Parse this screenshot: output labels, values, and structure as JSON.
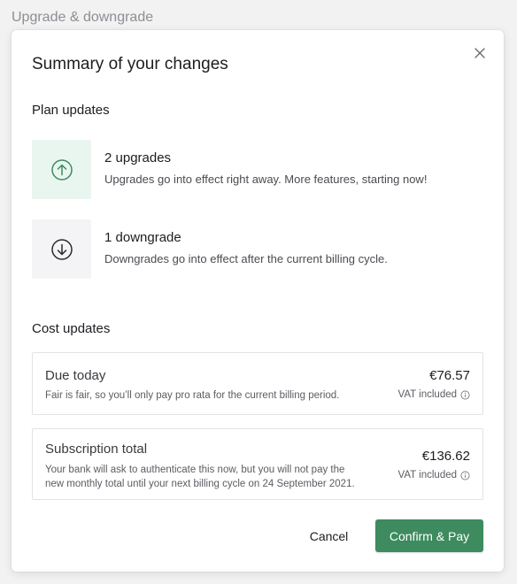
{
  "page": {
    "background_title": "Upgrade & downgrade"
  },
  "modal": {
    "title": "Summary of your changes",
    "close_icon": "close-icon"
  },
  "plan_updates": {
    "title": "Plan updates",
    "items": [
      {
        "icon": "arrow-up-circle-icon",
        "heading": "2 upgrades",
        "description": "Upgrades go into effect right away. More features, starting now!",
        "icon_color": "#3d8b5f",
        "background": "#e9f6ef"
      },
      {
        "icon": "arrow-down-circle-icon",
        "heading": "1 downgrade",
        "description": "Downgrades go into effect after the current billing cycle.",
        "icon_color": "#2a2a2f",
        "background": "#f4f4f6"
      }
    ]
  },
  "cost_updates": {
    "title": "Cost updates",
    "due_today": {
      "title": "Due today",
      "description": "Fair is fair, so you’ll only pay pro rata for the current billing period.",
      "amount": "€76.57",
      "vat": "VAT included"
    },
    "subscription_total": {
      "title": "Subscription total",
      "description_line1": "Your bank will ask to authenticate this now, but you will not pay the",
      "description_line2": "new monthly total until your next billing cycle on 24 September 2021.",
      "amount": "€136.62",
      "vat": "VAT included"
    }
  },
  "actions": {
    "cancel_label": "Cancel",
    "confirm_label": "Confirm & Pay",
    "confirm_color": "#3d8b5f"
  }
}
